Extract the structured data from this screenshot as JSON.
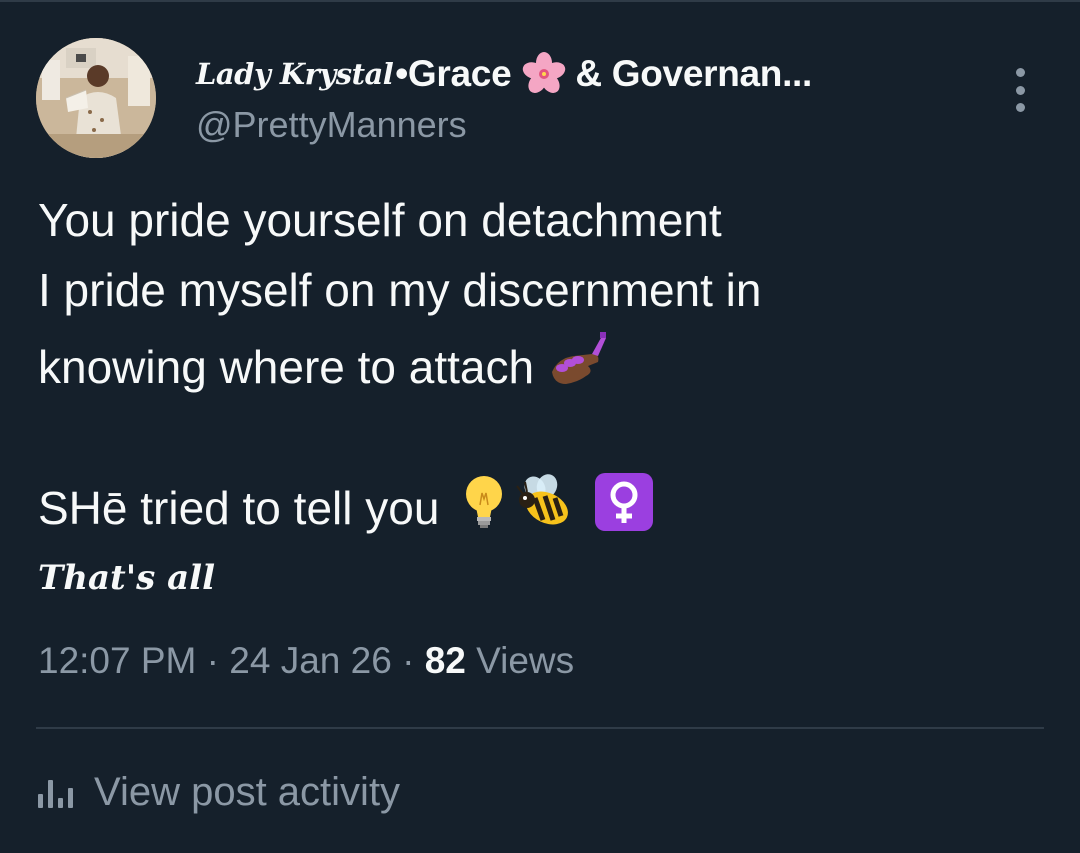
{
  "author": {
    "script_name": "Lady Krystal",
    "name_rest_before": "•Grace",
    "flower_icon": "cherry-blossom-icon",
    "name_rest_after": "& Governan...",
    "handle": "@PrettyManners"
  },
  "tweet": {
    "line1": "You pride yourself on detachment",
    "line2": "I pride myself on my discernment in",
    "line3": "knowing where to attach",
    "line3_emoji": "nail-polish-icon",
    "line4": "SHē tried to tell you",
    "line4_emojis": [
      "light-bulb-icon",
      "bee-icon",
      "female-sign-icon"
    ],
    "signoff": "That's all"
  },
  "meta": {
    "time": "12:07 PM",
    "separator": "·",
    "date": "24 Jan 26",
    "views_count": "82",
    "views_label": "Views"
  },
  "activity": {
    "icon": "bar-chart-icon",
    "label": "View post activity"
  },
  "colors": {
    "background": "#15202b",
    "primary_text": "#f7f9f9",
    "secondary_text": "#8b98a5",
    "divider": "#2f3b47"
  }
}
